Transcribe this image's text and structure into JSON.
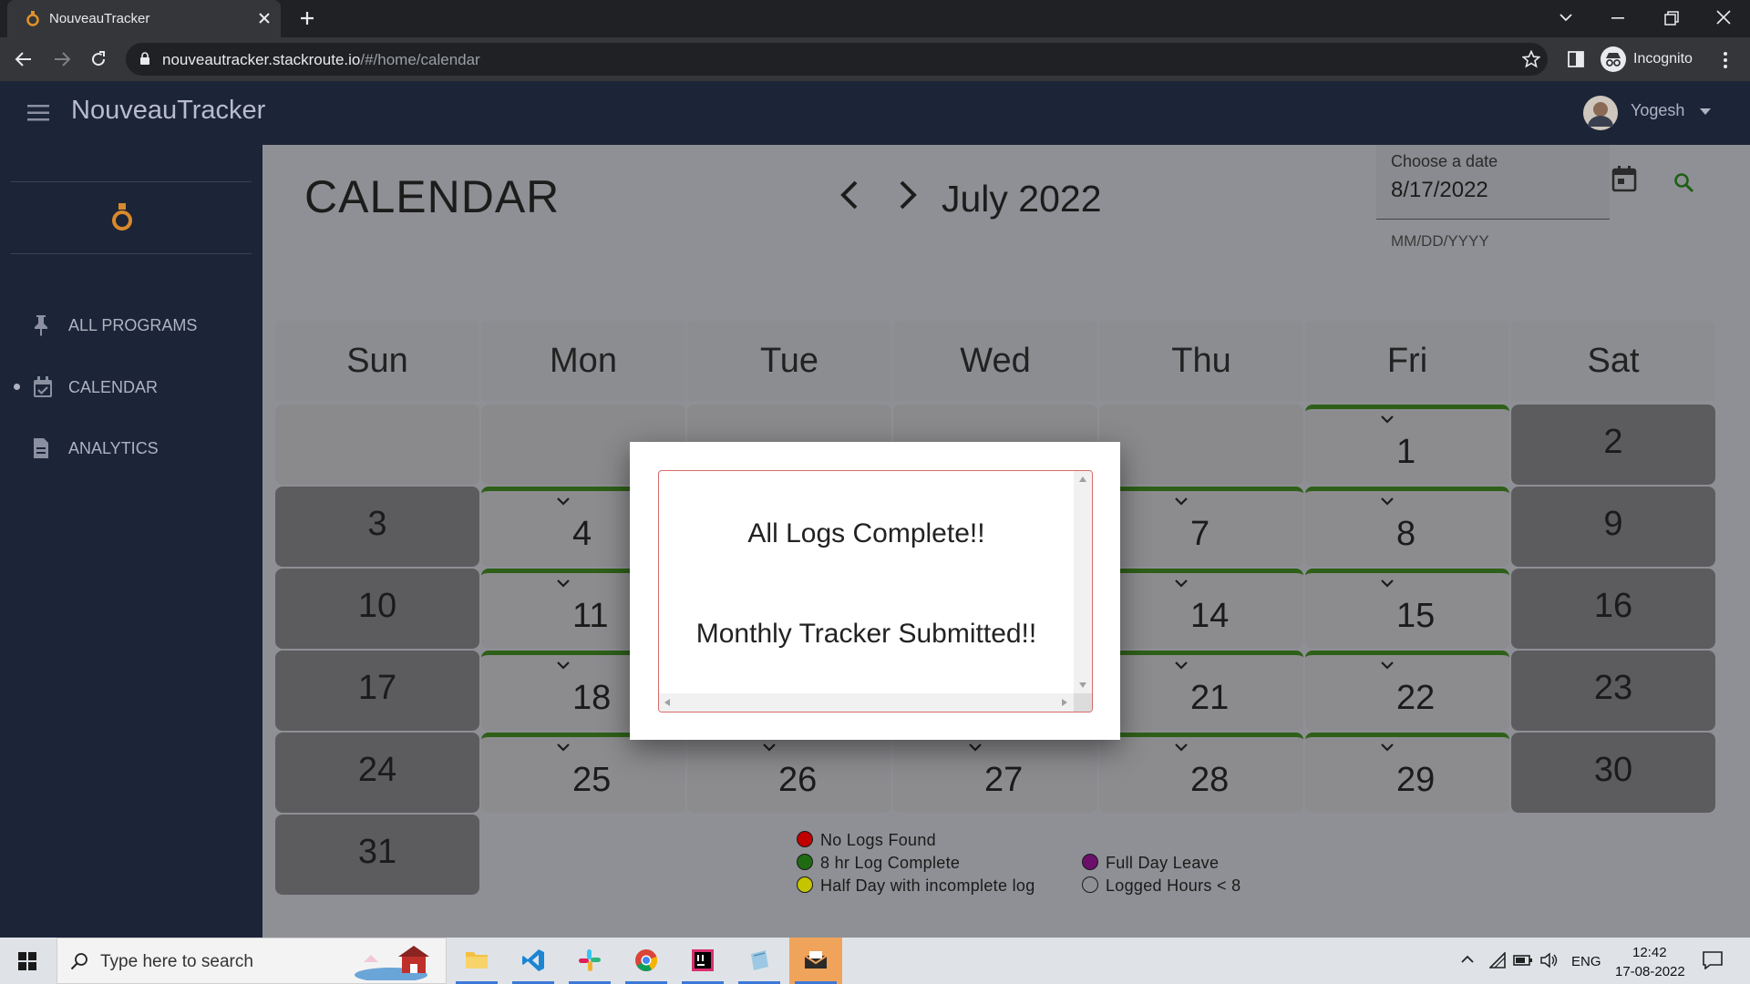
{
  "browser": {
    "tab_title": "NouveauTracker",
    "url_host": "nouveautracker.stackroute.io",
    "url_path": "/#/home/calendar",
    "profile_label": "Incognito"
  },
  "app": {
    "title": "NouveauTracker",
    "user_name": "Yogesh"
  },
  "sidebar": {
    "items": [
      {
        "label": "ALL PROGRAMS",
        "icon": "pin-icon"
      },
      {
        "label": "CALENDAR",
        "icon": "calendar-check-icon",
        "active": true
      },
      {
        "label": "ANALYTICS",
        "icon": "document-icon"
      }
    ]
  },
  "calendar": {
    "heading": "CALENDAR",
    "month_label": "July 2022",
    "date_field_label": "Choose a date",
    "date_value": "8/17/2022",
    "date_hint": "MM/DD/YYYY",
    "weekdays": [
      "Sun",
      "Mon",
      "Tue",
      "Wed",
      "Thu",
      "Fri",
      "Sat"
    ],
    "days": {
      "d1": "1",
      "d2": "2",
      "d3": "3",
      "d4": "4",
      "d7": "7",
      "d8": "8",
      "d9": "9",
      "d10": "10",
      "d11": "11",
      "d14": "14",
      "d15": "15",
      "d16": "16",
      "d17": "17",
      "d18": "18",
      "d21": "21",
      "d22": "22",
      "d23": "23",
      "d24": "24",
      "d25": "25",
      "d26": "26",
      "d27": "27",
      "d28": "28",
      "d29": "29",
      "d30": "30",
      "d31": "31"
    },
    "legend": {
      "no_logs": "No Logs Found",
      "full_log": "8 hr Log Complete",
      "half_day": "Half Day with incomplete log",
      "leave": "Full Day Leave",
      "partial": "Logged Hours < 8"
    },
    "legend_colors": {
      "no_logs": "#c00000",
      "full_log": "#1f6b12",
      "half_day": "#c4c400",
      "leave": "#6a0f6a",
      "partial": "transparent"
    }
  },
  "modal": {
    "line1": "All Logs Complete!!",
    "line2": "Monthly Tracker Submitted!!"
  },
  "taskbar": {
    "search_placeholder": "Type here to search",
    "language": "ENG",
    "time": "12:42",
    "date": "17-08-2022"
  }
}
